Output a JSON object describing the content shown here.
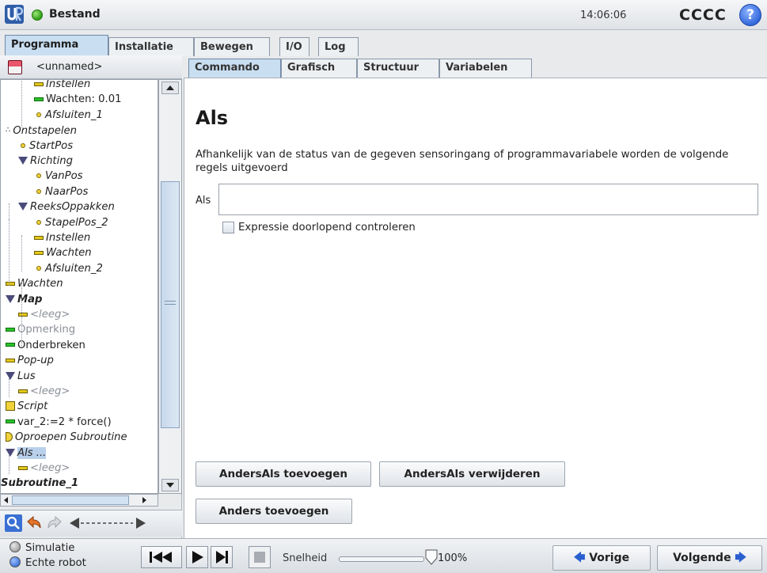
{
  "titlebar": {
    "title": "Bestand",
    "clock": "14:06:06",
    "robot_name": "CCCC",
    "help_glyph": "?"
  },
  "top_tabs": [
    "Programma",
    "Installatie",
    "Bewegen",
    "I/O",
    "Log"
  ],
  "file": {
    "name": "<unnamed>"
  },
  "tree": [
    {
      "label": "Instellen",
      "icon": "bar-yellow",
      "style": "it"
    },
    {
      "label": "Wachten: 0.01",
      "icon": "bar-green",
      "style": ""
    },
    {
      "label": "Afsluiten_1",
      "icon": "dot",
      "style": "it"
    },
    {
      "label": "Ontstapelen",
      "icon": "stack",
      "style": "it"
    },
    {
      "label": "StartPos",
      "icon": "dot",
      "style": "it"
    },
    {
      "label": "Richting",
      "icon": "triangle",
      "style": "it"
    },
    {
      "label": "VanPos",
      "icon": "dot",
      "style": "it"
    },
    {
      "label": "NaarPos",
      "icon": "dot",
      "style": "it"
    },
    {
      "label": "ReeksOppakken",
      "icon": "triangle",
      "style": "it"
    },
    {
      "label": "StapelPos_2",
      "icon": "dot",
      "style": "it"
    },
    {
      "label": "Instellen",
      "icon": "bar-yellow",
      "style": "it"
    },
    {
      "label": "Wachten",
      "icon": "bar-yellow",
      "style": "it"
    },
    {
      "label": "Afsluiten_2",
      "icon": "dot",
      "style": "it"
    },
    {
      "label": "Wachten",
      "icon": "bar-yellow",
      "style": "it"
    },
    {
      "label": "Map",
      "icon": "triangle",
      "style": "it b"
    },
    {
      "label": "<leeg>",
      "icon": "bar-yellow",
      "style": "it gray"
    },
    {
      "label": "Opmerking",
      "icon": "bar-green",
      "style": "gray"
    },
    {
      "label": "Onderbreken",
      "icon": "bar-green",
      "style": ""
    },
    {
      "label": "Pop-up",
      "icon": "bar-yellow",
      "style": "it"
    },
    {
      "label": "Lus",
      "icon": "triangle",
      "style": "it"
    },
    {
      "label": "<leeg>",
      "icon": "bar-yellow",
      "style": "it gray"
    },
    {
      "label": "Script",
      "icon": "script",
      "style": "it"
    },
    {
      "label": "var_2:=2 * force()",
      "icon": "bar-green",
      "style": ""
    },
    {
      "label": "Oproepen Subroutine",
      "icon": "call",
      "style": "it"
    },
    {
      "label": "Als ...",
      "icon": "triangle",
      "style": "it sel"
    },
    {
      "label": "<leeg>",
      "icon": "bar-yellow",
      "style": "it gray"
    },
    {
      "label": "Subroutine_1",
      "icon": "none",
      "style": "it b"
    }
  ],
  "right_tabs": [
    "Commando",
    "Grafisch",
    "Structuur",
    "Variabelen"
  ],
  "command": {
    "heading": "Als",
    "description": "Afhankelijk van de status van de gegeven sensoringang of programmavariabele worden de volgende regels uitgevoerd",
    "if_label": "Als",
    "if_value": "",
    "checkbox_label": "Expressie doorlopend controleren",
    "checkbox_checked": false,
    "btn_add_elseif": "AndersAls toevoegen",
    "btn_remove_elseif": "AndersAls verwijderen",
    "btn_add_else": "Anders toevoegen"
  },
  "footer": {
    "mode_sim": "Simulatie",
    "mode_real": "Echte robot",
    "speed_label": "Snelheid",
    "speed_value": "100%",
    "speed_fraction": 1.0,
    "prev": "Vorige",
    "next": "Volgende"
  },
  "colors": {
    "accent": "#2a5fcf",
    "tab_active": "#c9def1",
    "selection": "#b9d0ea"
  }
}
